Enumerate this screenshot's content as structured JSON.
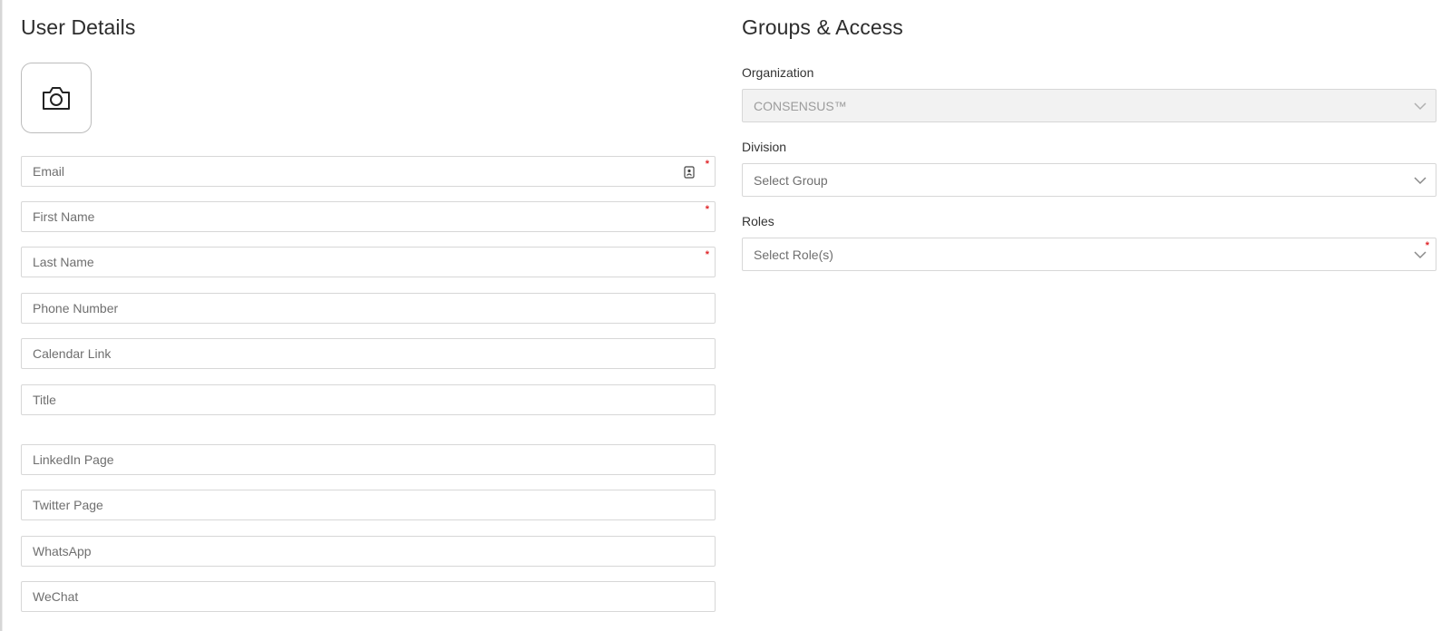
{
  "user_details": {
    "title": "User Details",
    "avatar_icon": "camera-icon",
    "email_placeholder": "Email",
    "first_name_placeholder": "First Name",
    "last_name_placeholder": "Last Name",
    "phone_placeholder": "Phone Number",
    "calendar_placeholder": "Calendar Link",
    "title_placeholder": "Title",
    "linkedin_placeholder": "LinkedIn Page",
    "twitter_placeholder": "Twitter Page",
    "whatsapp_placeholder": "WhatsApp",
    "wechat_placeholder": "WeChat",
    "required_marker": "*"
  },
  "groups_access": {
    "title": "Groups & Access",
    "organization_label": "Organization",
    "organization_value": "CONSENSUS™",
    "division_label": "Division",
    "division_value": "Select Group",
    "roles_label": "Roles",
    "roles_value": "Select Role(s)"
  },
  "colors": {
    "required": "#e0262a",
    "border": "#d7d7d7",
    "disabled_bg": "#f2f2f2"
  }
}
